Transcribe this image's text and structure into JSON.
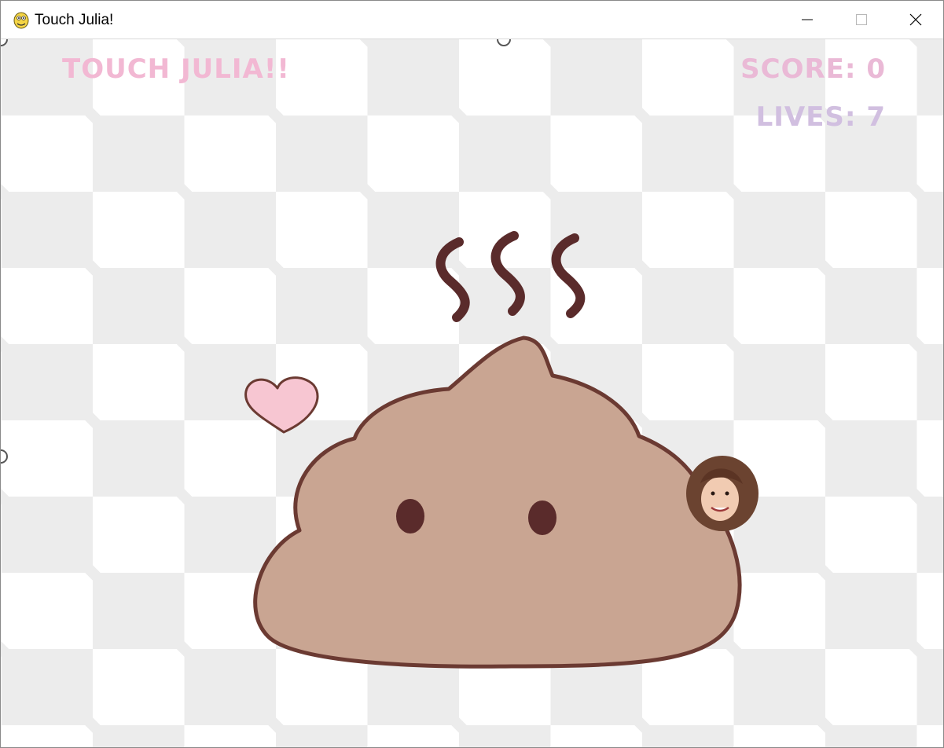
{
  "window": {
    "title": "Touch Julia!"
  },
  "hud": {
    "title": "TOUCH JULIA!!",
    "score_text": "SCORE: 0",
    "lives_text": "LIVES: 7"
  },
  "colors": {
    "title_pink": "#f2b8d3",
    "score_pink": "#eab9d6",
    "lives_lavender": "#d1bfe0",
    "poop_body": "#c9a592",
    "poop_outline": "#6b3a32",
    "heart": "#f7c6d2",
    "checker": "#ececec"
  },
  "icons": {
    "app": "python-snake-icon",
    "minimize": "minimize-icon",
    "maximize": "maximize-icon",
    "close": "close-icon"
  }
}
